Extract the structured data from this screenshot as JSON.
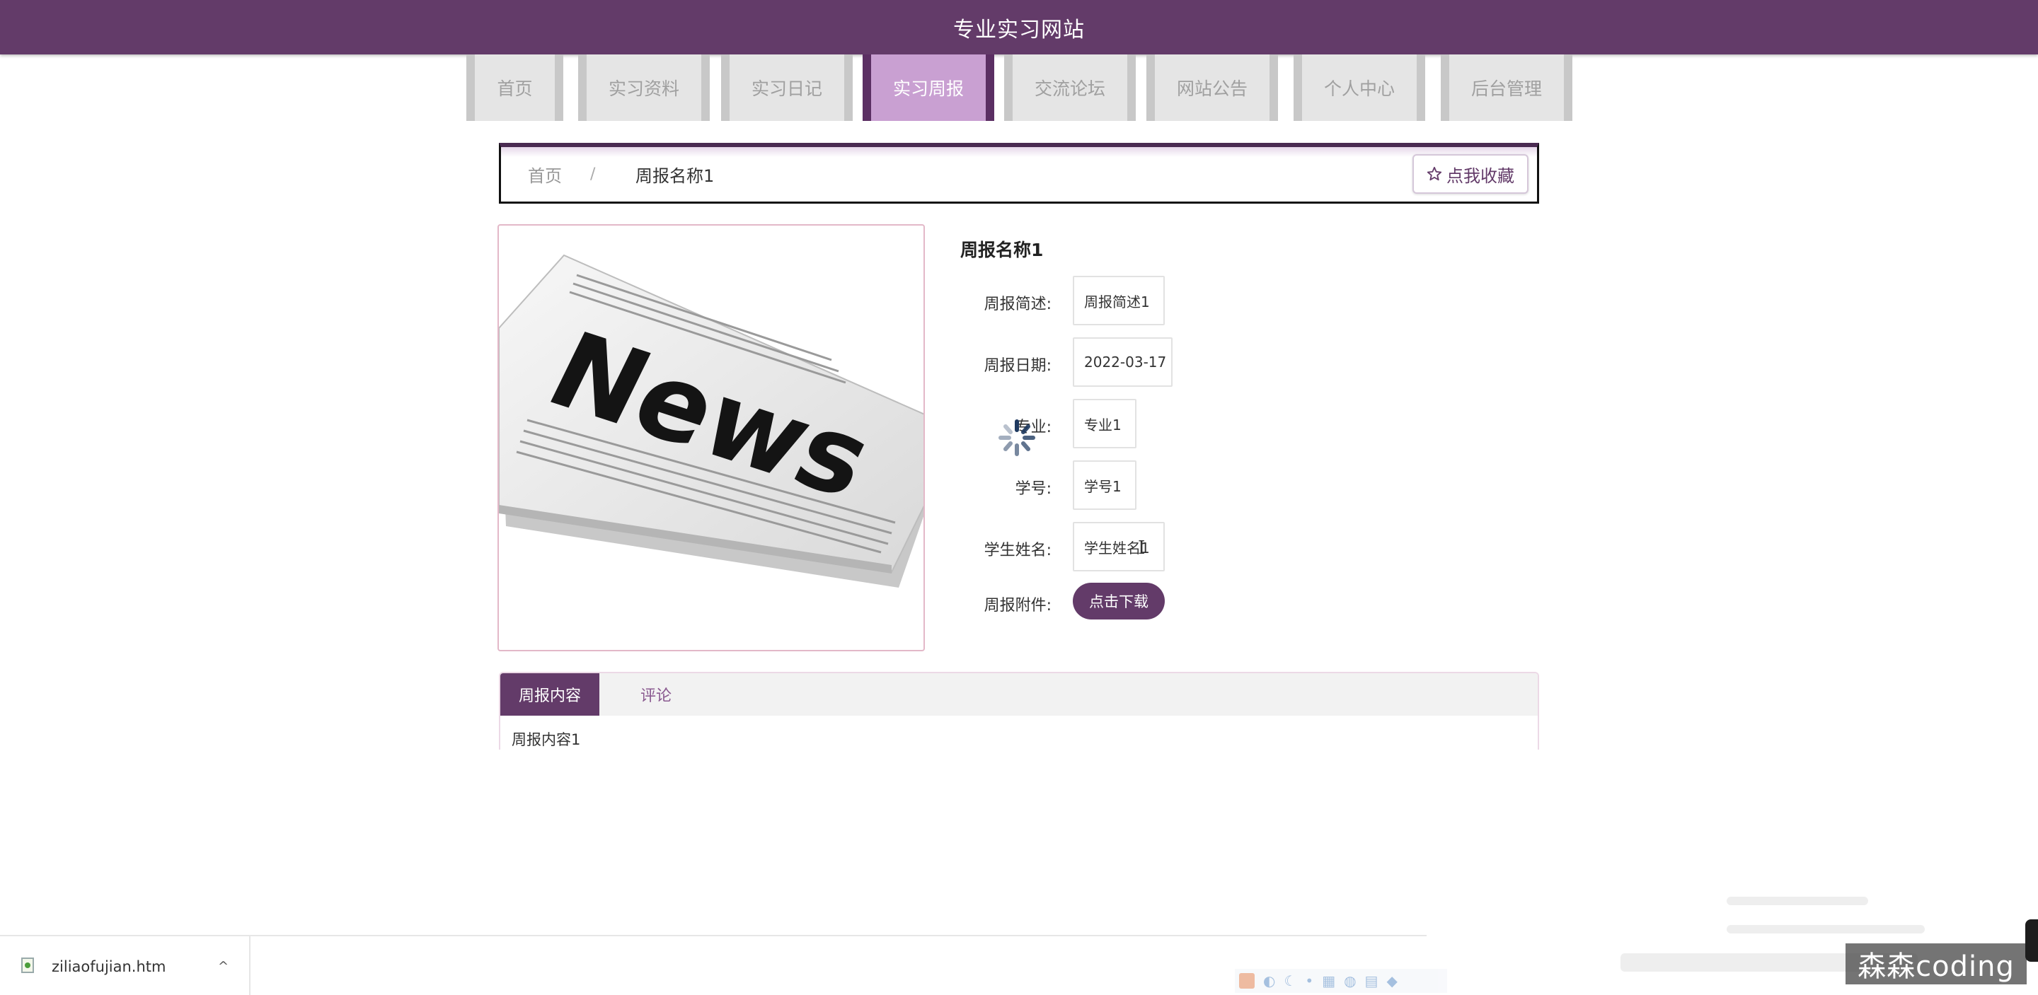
{
  "header": {
    "title": "专业实习网站"
  },
  "nav": {
    "items": [
      {
        "label": "首页",
        "active": false
      },
      {
        "label": "实习资料",
        "active": false
      },
      {
        "label": "实习日记",
        "active": false
      },
      {
        "label": "实习周报",
        "active": true
      },
      {
        "label": "交流论坛",
        "active": false
      },
      {
        "label": "网站公告",
        "active": false
      },
      {
        "label": "个人中心",
        "active": false
      },
      {
        "label": "后台管理",
        "active": false
      }
    ]
  },
  "breadcrumb": {
    "home": "首页",
    "separator": "/",
    "current": "周报名称1"
  },
  "favorite_button": {
    "icon": "star-outline-icon",
    "label": "点我收藏"
  },
  "image": {
    "alt_icon": "newspaper-image",
    "word": "News"
  },
  "detail": {
    "title": "周报名称1",
    "fields": [
      {
        "label": "周报简述:",
        "value": "周报简述1"
      },
      {
        "label": "周报日期:",
        "value": "2022-03-17"
      },
      {
        "label": "专业:",
        "value": "专业1"
      },
      {
        "label": "学号:",
        "value": "学号1"
      },
      {
        "label": "学生姓名:",
        "value": "学生姓名1"
      }
    ],
    "attachment_label": "周报附件:",
    "download_label": "点击下载"
  },
  "tabs": {
    "items": [
      {
        "label": "周报内容",
        "active": true
      },
      {
        "label": "评论",
        "active": false
      }
    ],
    "content": "周报内容1"
  },
  "download_bar": {
    "file_name": "ziliaofujian.htm",
    "chevron": "^"
  },
  "watermark": "森森coding",
  "colors": {
    "primary": "#633b69",
    "nav_active": "#c9a0d2",
    "nav_bg": "#e5e5e5"
  }
}
